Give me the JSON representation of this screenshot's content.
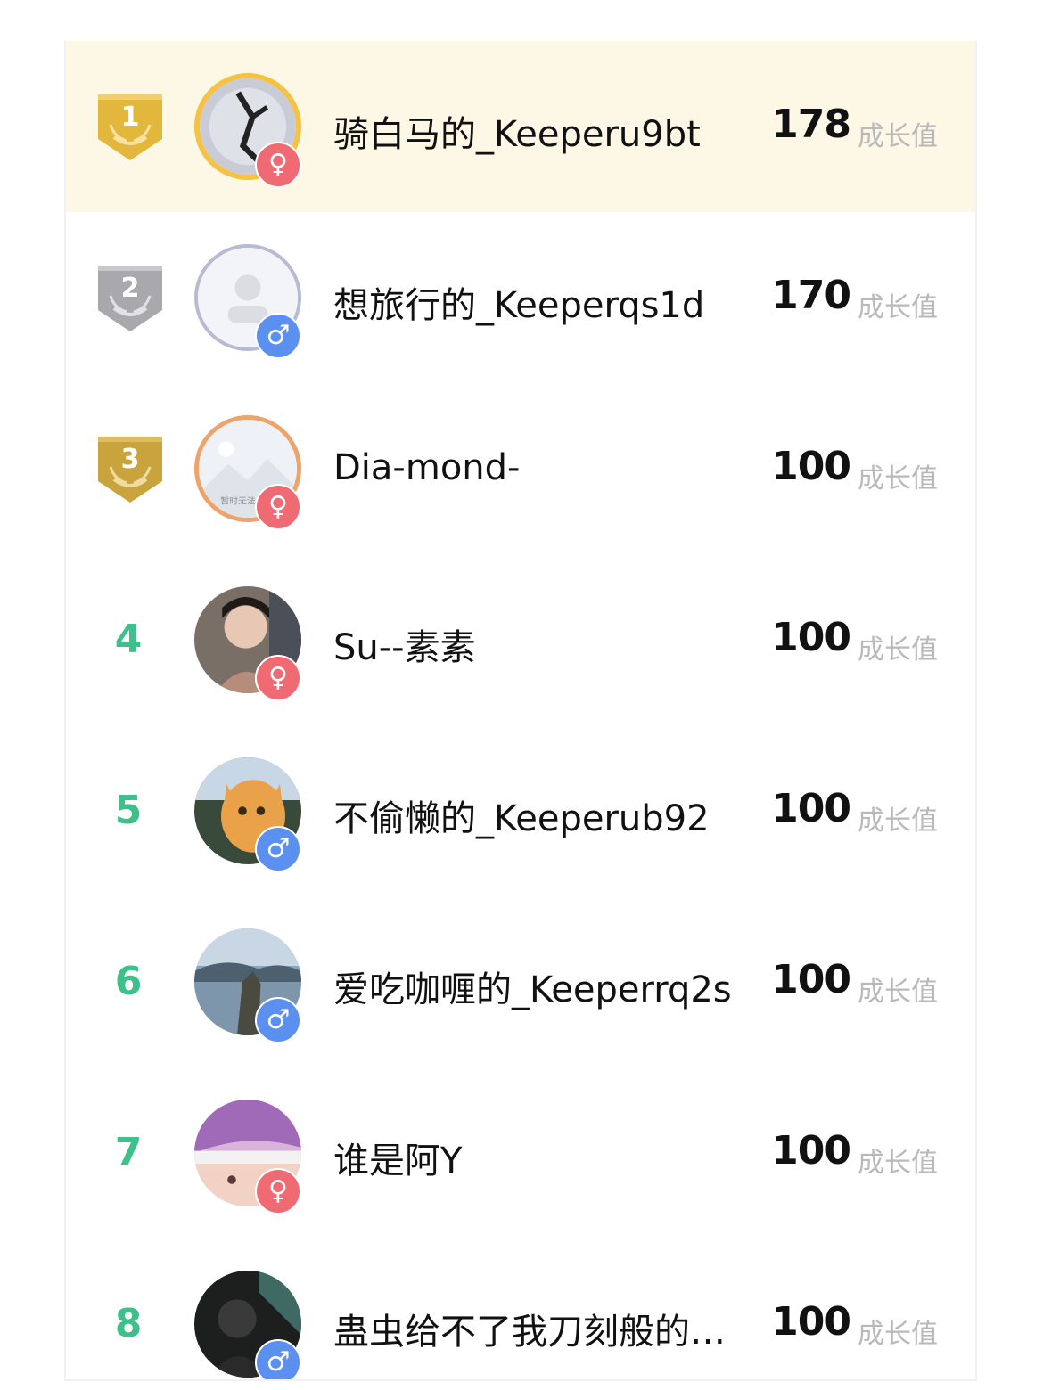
{
  "unit_label": "成长值",
  "colors": {
    "highlight": "#fdf7e6",
    "rank_green": "#3dc08a",
    "gold_medal": "#e3b73b",
    "silver_medal": "#a9a9ad",
    "bronze_medal": "#c9a33c",
    "female": "#f06a74",
    "male": "#5b8ff0"
  },
  "rows": [
    {
      "rank": "1",
      "name": "骑白马的_Keeperu9bt",
      "score": "178",
      "gender": "♀",
      "gender_icon": "female-icon"
    },
    {
      "rank": "2",
      "name": "想旅行的_Keeperqs1d",
      "score": "170",
      "gender": "♂",
      "gender_icon": "male-icon"
    },
    {
      "rank": "3",
      "name": "Dia-mond-",
      "score": "100",
      "gender": "♀",
      "gender_icon": "female-icon",
      "avatar_caption": "暂时无法"
    },
    {
      "rank": "4",
      "name": "Su--素素",
      "score": "100",
      "gender": "♀",
      "gender_icon": "female-icon"
    },
    {
      "rank": "5",
      "name": "不偷懒的_Keeperub92",
      "score": "100",
      "gender": "♂",
      "gender_icon": "male-icon"
    },
    {
      "rank": "6",
      "name": "爱吃咖喱的_Keeperrq2s",
      "score": "100",
      "gender": "♂",
      "gender_icon": "male-icon"
    },
    {
      "rank": "7",
      "name": "谁是阿Y",
      "score": "100",
      "gender": "♀",
      "gender_icon": "female-icon"
    },
    {
      "rank": "8",
      "name": "蛊虫给不了我刀刻般的…",
      "score": "100",
      "gender": "♂",
      "gender_icon": "male-icon"
    }
  ]
}
